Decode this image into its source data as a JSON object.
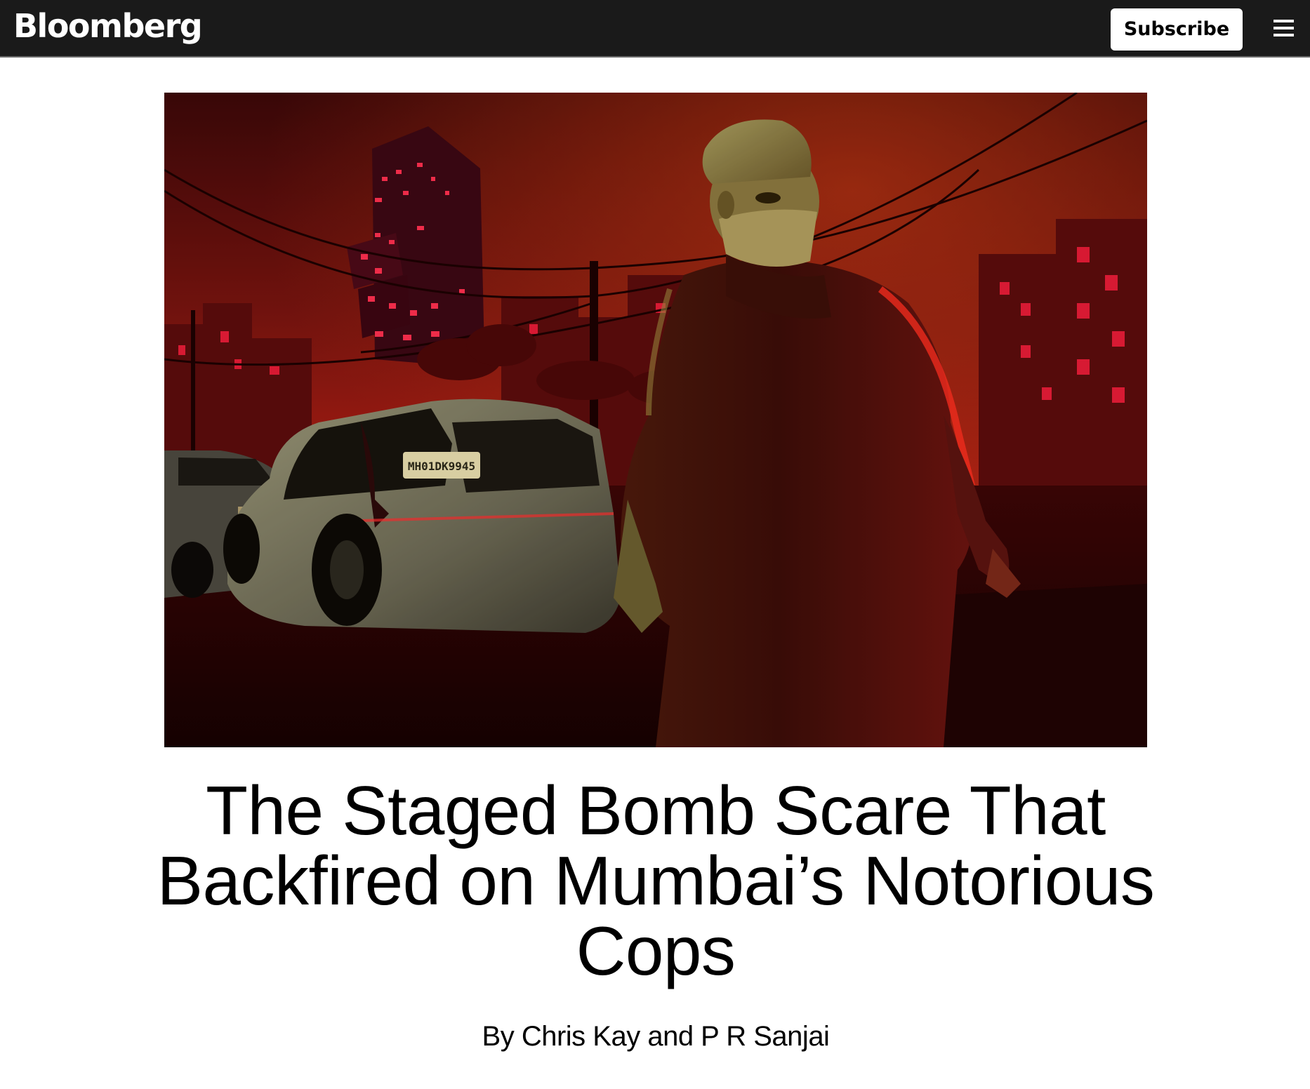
{
  "header": {
    "logo_text": "Bloomberg",
    "subscribe_label": "Subscribe",
    "menu_icon": "hamburger-menu-icon",
    "background_color": "#1a1a1a"
  },
  "hero_image": {
    "plate_text": "MH01DK9945"
  },
  "article": {
    "headline": "The Staged Bomb Scare That Backfired on Mumbai’s Notorious Cops",
    "byline": "By Chris Kay and P R Sanjai"
  }
}
